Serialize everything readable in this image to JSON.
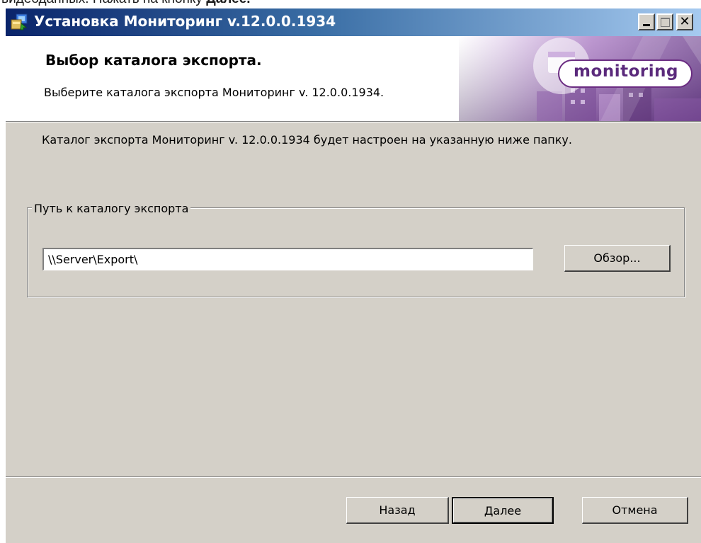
{
  "doc_snippet": {
    "text_start": "видеоданных. Нажать на кнопку ",
    "text_bold": "Далее."
  },
  "window": {
    "title": "Установка Мониторинг v.12.0.0.1934",
    "controls": {
      "minimize": "minimize",
      "maximize": "maximize",
      "close": "✕"
    }
  },
  "banner": {
    "title": "Выбор каталога экспорта.",
    "subtitle": "Выберите каталога экспорта Мониторинг v. 12.0.0.1934.",
    "logo_text": "monitoring",
    "brand_color": "#5b2a7c"
  },
  "content": {
    "description": "Каталог экспорта Мониторинг v. 12.0.0.1934 будет настроен на указанную ниже папку.",
    "group_label": "Путь к каталогу экспорта",
    "path_value": "\\\\Server\\Export\\",
    "browse_label": "Обзор..."
  },
  "footer": {
    "back_label": "Назад",
    "next_label": "Далее",
    "cancel_label": "Отмена"
  }
}
